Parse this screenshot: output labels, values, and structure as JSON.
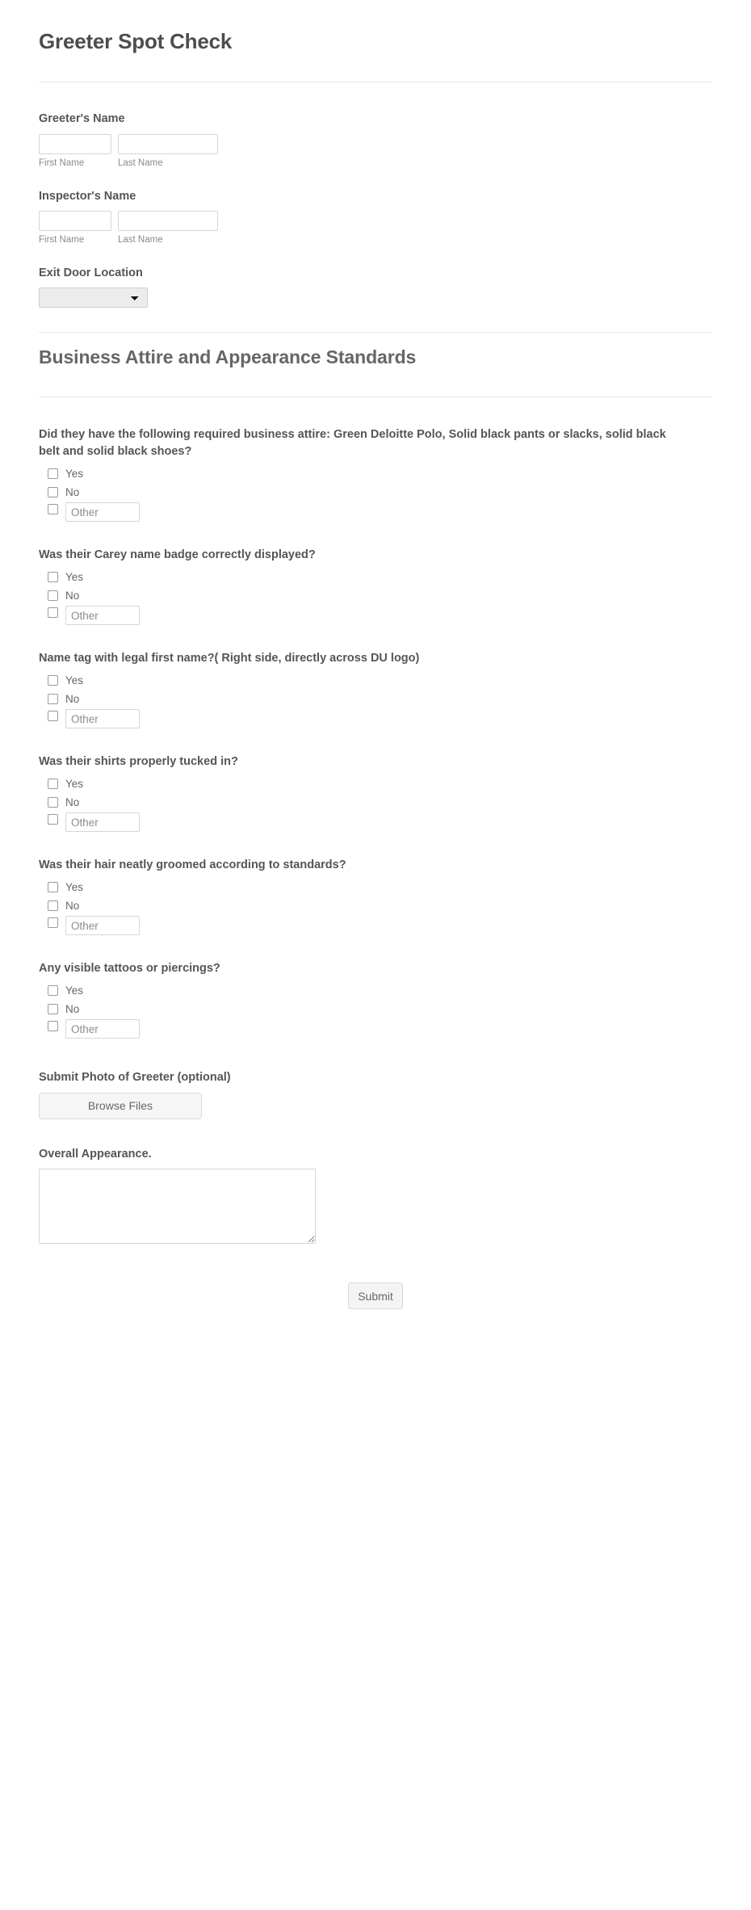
{
  "form": {
    "title": "Greeter Spot Check",
    "submit_label": "Submit"
  },
  "contact_section": {
    "greeter_name": {
      "label": "Greeter's Name",
      "first": {
        "value": "",
        "sub_label": "First Name"
      },
      "last": {
        "value": "",
        "sub_label": "Last Name"
      }
    },
    "inspector_name": {
      "label": "Inspector's Name",
      "first": {
        "value": "",
        "sub_label": "First Name"
      },
      "last": {
        "value": "",
        "sub_label": "Last Name"
      }
    },
    "exit_door_location": {
      "label": "Exit Door Location",
      "selected": ""
    }
  },
  "attire_section": {
    "heading": "Business Attire and Appearance Standards",
    "other_placeholder": "Other",
    "yes_label": "Yes",
    "no_label": "No",
    "questions": [
      {
        "text": "Did they have the following required business attire: Green Deloitte Polo, Solid black pants or slacks, solid black belt and solid black shoes?"
      },
      {
        "text": "Was their Carey name badge correctly displayed?"
      },
      {
        "text": "Name tag with legal first name?( Right side, directly across DU logo)"
      },
      {
        "text": "Was their shirts properly tucked in?"
      },
      {
        "text": "Was their hair neatly groomed according to standards?"
      },
      {
        "text": "Any visible tattoos or piercings?"
      }
    ],
    "photo_upload": {
      "label": "Submit Photo of Greeter (optional)",
      "button_label": "Browse Files"
    },
    "overall_appearance": {
      "label": "Overall Appearance.",
      "value": ""
    }
  }
}
